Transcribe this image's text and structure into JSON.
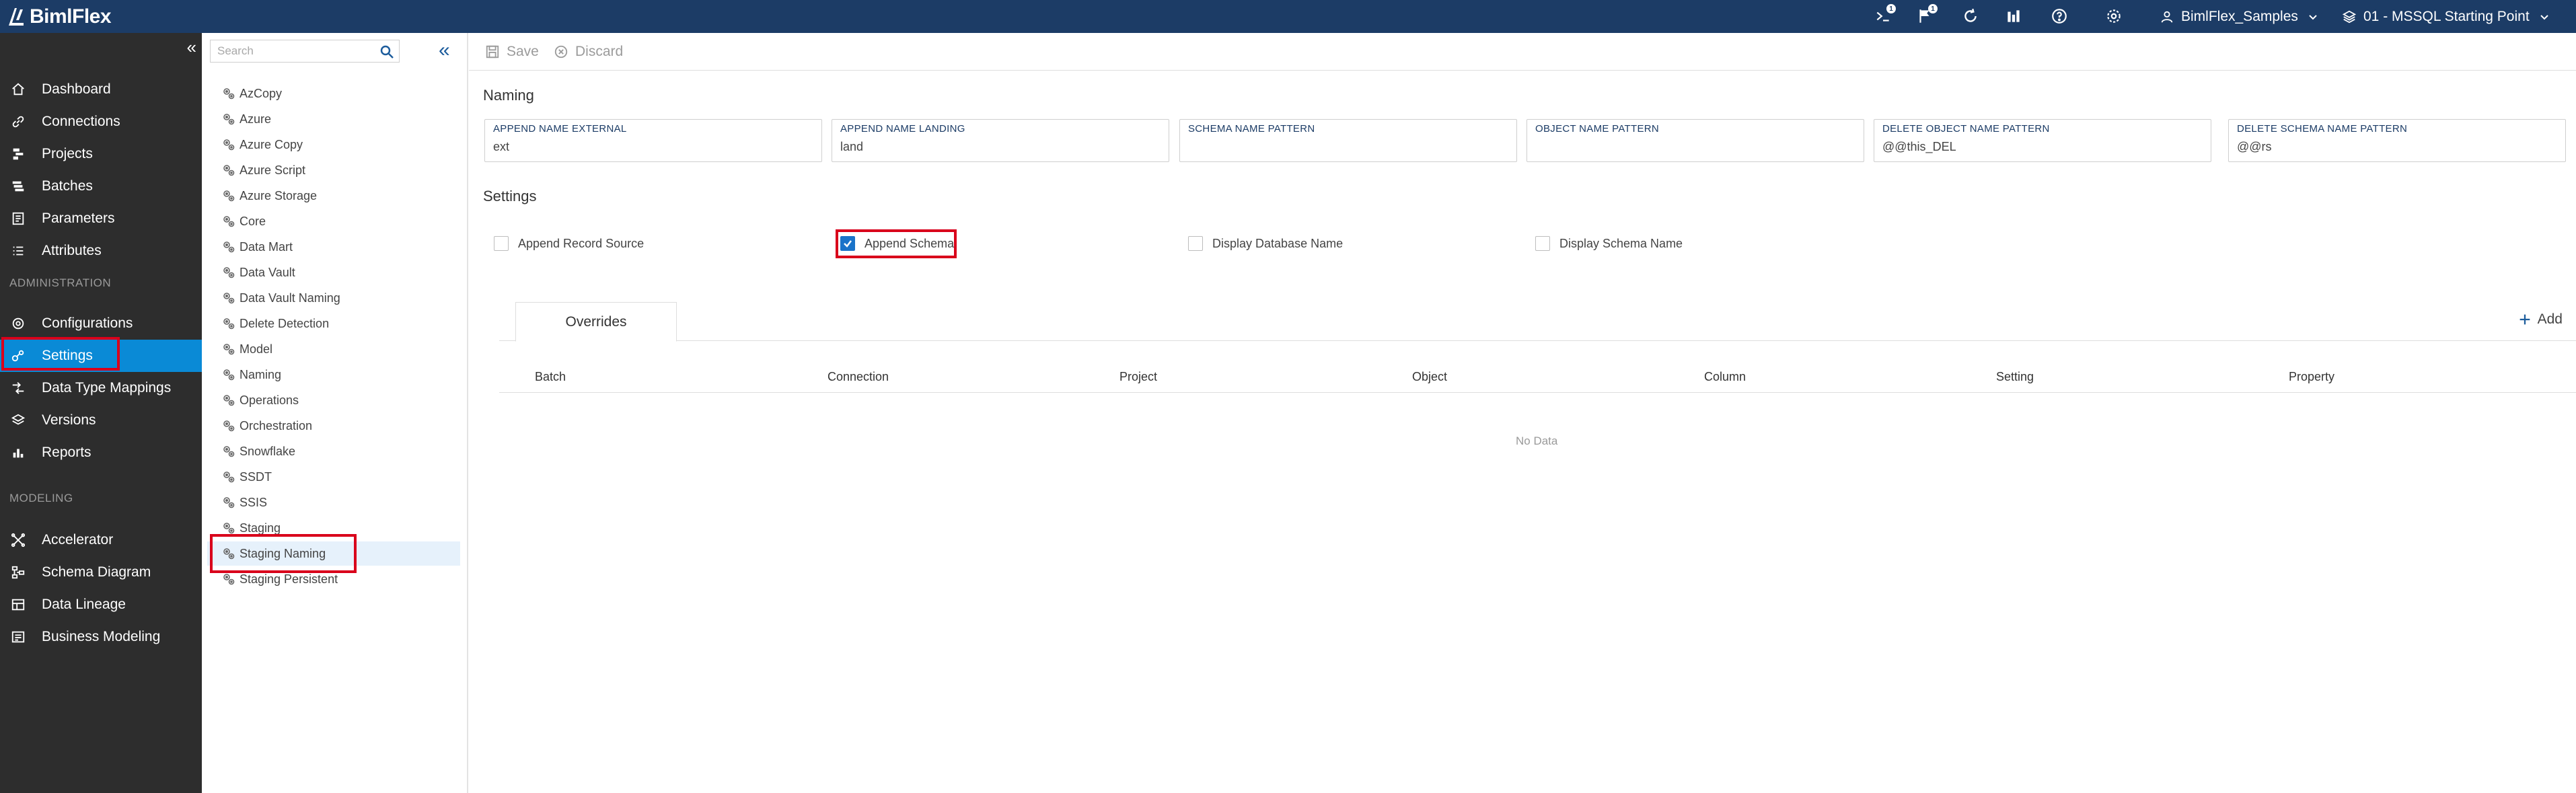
{
  "app": {
    "title": "BimlFlex"
  },
  "topbar": {
    "notifications_badge": "1",
    "flags_badge": "1",
    "user": "BimlFlex_Samples",
    "version": "01 - MSSQL Starting Point"
  },
  "sidebar": {
    "items": [
      {
        "label": "Dashboard",
        "icon": "home-icon"
      },
      {
        "label": "Connections",
        "icon": "link-icon"
      },
      {
        "label": "Projects",
        "icon": "projects-icon"
      },
      {
        "label": "Batches",
        "icon": "batches-icon"
      },
      {
        "label": "Parameters",
        "icon": "parameters-icon"
      },
      {
        "label": "Attributes",
        "icon": "attributes-icon"
      }
    ],
    "administration_label": "ADMINISTRATION",
    "admin_items": [
      {
        "label": "Configurations",
        "icon": "configurations-icon"
      },
      {
        "label": "Settings",
        "icon": "settings-icon",
        "active": true
      },
      {
        "label": "Data Type Mappings",
        "icon": "data-type-mappings-icon"
      },
      {
        "label": "Versions",
        "icon": "versions-icon"
      },
      {
        "label": "Reports",
        "icon": "reports-icon"
      }
    ],
    "modeling_label": "MODELING",
    "modeling_items": [
      {
        "label": "Accelerator",
        "icon": "accelerator-icon"
      },
      {
        "label": "Schema Diagram",
        "icon": "schema-diagram-icon"
      },
      {
        "label": "Data Lineage",
        "icon": "data-lineage-icon"
      },
      {
        "label": "Business Modeling",
        "icon": "business-modeling-icon"
      }
    ]
  },
  "tree": {
    "search_placeholder": "Search",
    "items": [
      "AzCopy",
      "Azure",
      "Azure Copy",
      "Azure Script",
      "Azure Storage",
      "Core",
      "Data Mart",
      "Data Vault",
      "Data Vault Naming",
      "Delete Detection",
      "Model",
      "Naming",
      "Operations",
      "Orchestration",
      "Snowflake",
      "SSDT",
      "SSIS",
      "Staging",
      "Staging Naming",
      "Staging Persistent"
    ],
    "selected": "Staging Naming"
  },
  "toolbar": {
    "save_label": "Save",
    "discard_label": "Discard"
  },
  "naming": {
    "title": "Naming",
    "fields": [
      {
        "label": "APPEND NAME EXTERNAL",
        "value": "ext"
      },
      {
        "label": "APPEND NAME LANDING",
        "value": "land"
      },
      {
        "label": "SCHEMA NAME PATTERN",
        "value": ""
      },
      {
        "label": "OBJECT NAME PATTERN",
        "value": ""
      },
      {
        "label": "DELETE OBJECT NAME PATTERN",
        "value": "@@this_DEL"
      },
      {
        "label": "DELETE SCHEMA NAME PATTERN",
        "value": "@@rs"
      }
    ]
  },
  "settings": {
    "title": "Settings",
    "checkboxes": [
      {
        "label": "Append Record Source",
        "checked": false
      },
      {
        "label": "Append Schema",
        "checked": true
      },
      {
        "label": "Display Database Name",
        "checked": false
      },
      {
        "label": "Display Schema Name",
        "checked": false
      }
    ]
  },
  "overrides": {
    "tab_label": "Overrides",
    "add_label": "Add",
    "columns": [
      "Batch",
      "Connection",
      "Project",
      "Object",
      "Column",
      "Setting",
      "Property"
    ],
    "empty_text": "No Data"
  },
  "colors": {
    "topbar": "#1c3c66",
    "sidebar": "#2d2d2d",
    "active": "#0a8ad6",
    "highlight": "#d9001b"
  }
}
